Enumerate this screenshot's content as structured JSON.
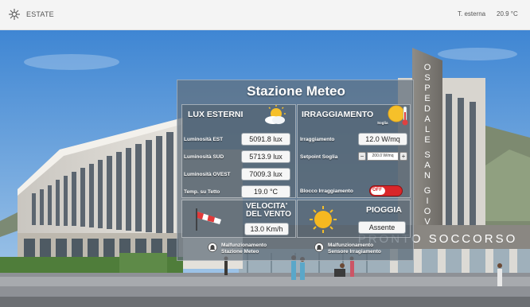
{
  "topbar": {
    "season_icon": "snowflake-sun-icon",
    "season": "ESTATE",
    "external_temp_label": "T. esterna",
    "external_temp_value": "20.9 °C"
  },
  "panel": {
    "title": "Stazione Meteo",
    "lux": {
      "title": "LUX ESTERNI",
      "icon": "partly-cloudy-icon",
      "rows": [
        {
          "label": "Luminosità EST",
          "value": "5091.8 lux"
        },
        {
          "label": "Luminosità SUD",
          "value": "5713.9 lux"
        },
        {
          "label": "Luminosità OVEST",
          "value": "7009.3 lux"
        },
        {
          "label": "Temp. su Tetto",
          "value": "19.0 °C"
        }
      ]
    },
    "irr": {
      "title": "IRRAGGIAMENTO",
      "icon": "sun-thermometer-icon",
      "soglia_label": "Soglia",
      "irraggiamento_label": "Irraggiamento",
      "irraggiamento_value": "12.0 W/mq",
      "setpoint_label": "Setpoint Soglia",
      "setpoint_value": "200.0 W/mq",
      "minus": "−",
      "plus": "+",
      "blocco_label": "Blocco Irraggiamento",
      "blocco_state": "OFF"
    },
    "wind": {
      "title_line1": "VELOCITA'",
      "title_line2": "DEL VENTO",
      "icon": "windsock-icon",
      "value": "13.0 Km/h"
    },
    "rain": {
      "title": "PIOGGIA",
      "icon": "sun-icon",
      "value": "Assente"
    },
    "alarms": [
      {
        "line1": "Malfunzionamento",
        "line2": "Stazione Meteo",
        "icon": "alarm-bell-icon"
      },
      {
        "line1": "Malfunzionamento",
        "line2": "Sensore Irragiamento",
        "icon": "alarm-bell-icon"
      }
    ]
  },
  "building": {
    "vertical_sign": "OSPEDALE SAN GIOVANNI",
    "horizontal_sign": "PRONTO SOCCORSO"
  },
  "colors": {
    "panel_bg": "#5f6e7a",
    "toggle_off": "#d9262a",
    "sky": "#4f93d8"
  }
}
